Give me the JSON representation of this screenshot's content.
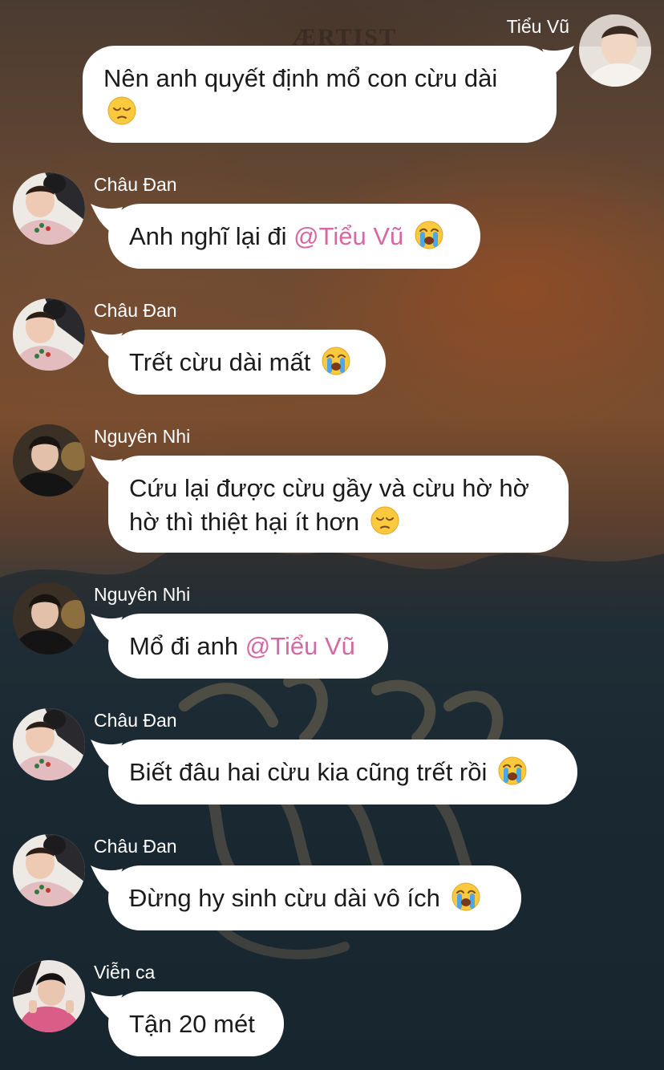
{
  "background": {
    "poster_text": "ÆRTIST"
  },
  "messages": [
    {
      "sender": "Tiểu Vũ",
      "side": "right",
      "avatar": "avatar-tieu-vu",
      "text": "Nên anh quyết định mổ con cừu dài",
      "emoji": "pensive-face-emoji"
    },
    {
      "sender": "Châu Đan",
      "side": "left",
      "avatar": "avatar-chau-dan",
      "text": "Anh nghĩ lại đi",
      "mention": "@Tiểu Vũ",
      "emoji": "loudly-crying-face-emoji"
    },
    {
      "sender": "Châu Đan",
      "side": "left",
      "avatar": "avatar-chau-dan",
      "text": "Trết cừu dài mất",
      "emoji": "loudly-crying-face-emoji"
    },
    {
      "sender": "Nguyên Nhi",
      "side": "left",
      "avatar": "avatar-nguyen-nhi",
      "text": "Cứu lại được cừu gầy và cừu hờ hờ hờ thì thiệt hại ít hơn",
      "emoji": "pensive-face-emoji"
    },
    {
      "sender": "Nguyên Nhi",
      "side": "left",
      "avatar": "avatar-nguyen-nhi",
      "text": "Mổ đi anh",
      "mention": "@Tiểu Vũ"
    },
    {
      "sender": "Châu Đan",
      "side": "left",
      "avatar": "avatar-chau-dan",
      "text": "Biết đâu hai cừu kia cũng trết rồi",
      "emoji": "loudly-crying-face-emoji"
    },
    {
      "sender": "Châu Đan",
      "side": "left",
      "avatar": "avatar-chau-dan",
      "text": "Đừng hy sinh cừu dài vô ích",
      "emoji": "loudly-crying-face-emoji"
    },
    {
      "sender": "Viễn ca",
      "side": "left",
      "avatar": "avatar-vien-ca",
      "text": "Tận 20 mét"
    }
  ],
  "colors": {
    "bubble": "#ffffff",
    "mention": "#d568a3",
    "name_text": "#ffffff",
    "message_text": "#1b1b1b"
  }
}
